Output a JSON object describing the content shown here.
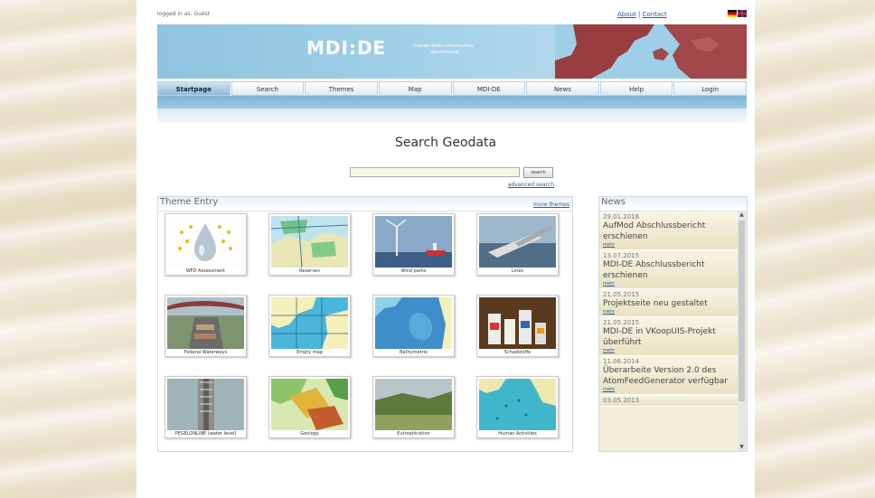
{
  "header": {
    "logged_in": "logged in as: Guest",
    "about": "About",
    "separator": "|",
    "contact": "Contact",
    "logo": "MDI:DE",
    "logo_sub_line1": "marine daten infrastruktur",
    "logo_sub_line2": "deutschland"
  },
  "nav": [
    {
      "label": "Startpage"
    },
    {
      "label": "Search"
    },
    {
      "label": "Themes"
    },
    {
      "label": "Map"
    },
    {
      "label": "MDI-DE"
    },
    {
      "label": "News"
    },
    {
      "label": "Help"
    },
    {
      "label": "Login"
    }
  ],
  "search": {
    "title": "Search Geodata",
    "button": "search",
    "advanced": "advanced search",
    "value": ""
  },
  "themes": {
    "title": "Theme Entry",
    "more": "more themes",
    "tiles": [
      {
        "label": "WFD Assessment"
      },
      {
        "label": "Reserves"
      },
      {
        "label": "Wind parks"
      },
      {
        "label": "Lines"
      },
      {
        "label": "Federal Waterways"
      },
      {
        "label": "Empty map"
      },
      {
        "label": "Bathymetrie"
      },
      {
        "label": "Schadstoffe"
      },
      {
        "label": "PEGELONLINE (water level)"
      },
      {
        "label": "Geology"
      },
      {
        "label": "Eutrophication"
      },
      {
        "label": "Human Activities"
      }
    ]
  },
  "news": {
    "title": "News",
    "items": [
      {
        "date": "29.01.2016",
        "text": "AufMod Abschlussbericht erschienen",
        "more": "mehr"
      },
      {
        "date": "13.07.2015",
        "text": "MDI-DE Abschlussbericht erschienen",
        "more": "mehr"
      },
      {
        "date": "21.05.2015",
        "text": "Projektseite neu gestaltet",
        "more": "mehr"
      },
      {
        "date": "21.05.2015",
        "text": "MDI-DE in VKoopUIS-Projekt überführt",
        "more": "mehr"
      },
      {
        "date": "11.06.2014",
        "text": "Überarbeite Version 2.0 des AtomFeedGenerator verfügbar",
        "more": "mehr"
      },
      {
        "date": "03.05.2013",
        "text": "",
        "more": ""
      }
    ]
  }
}
